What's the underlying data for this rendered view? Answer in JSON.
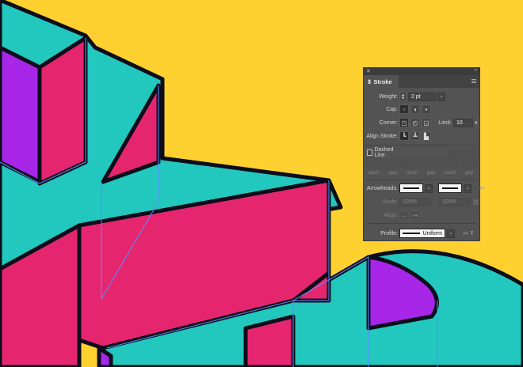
{
  "colors": {
    "background": "#FFD130",
    "teal": "#22C7BE",
    "magenta": "#E5266E",
    "purple": "#A726E8",
    "path": "#5b8cff"
  },
  "panel": {
    "title": "Stroke",
    "weight_label": "Weight:",
    "weight_value": "2 pt",
    "cap_label": "Cap:",
    "corner_label": "Corner:",
    "limit_label": "Limit:",
    "limit_value": "10",
    "limit_unit": "x",
    "align_label": "Align Stroke:",
    "dashed_label": "Dashed Line",
    "dashed_checked": false,
    "dash_fields": [
      "dash",
      "gap",
      "dash",
      "gap",
      "dash",
      "gap"
    ],
    "arrowheads_label": "Arrowheads:",
    "scale_label": "Scale:",
    "scale_values": [
      "100%",
      "100%"
    ],
    "align_arrow_label": "Align:",
    "profile_label": "Profile:",
    "profile_value": "Uniform"
  }
}
